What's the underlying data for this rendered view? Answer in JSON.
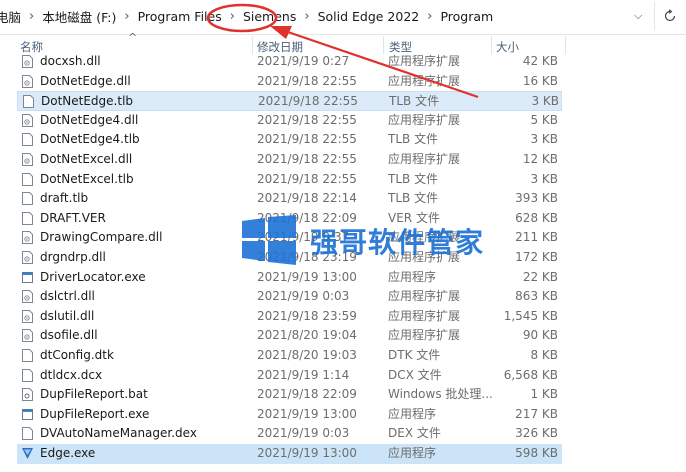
{
  "address": {
    "crumbs": [
      "电脑",
      "本地磁盘 (F:)",
      "Program Files",
      "Siemens",
      "Solid Edge 2022",
      "Program"
    ]
  },
  "columns": {
    "name": "名称",
    "date": "修改日期",
    "type": "类型",
    "size": "大小"
  },
  "files": [
    {
      "name": "docxsh.dll",
      "date": "2021/9/19 0:27",
      "type": "应用程序扩展",
      "size": "42 KB",
      "icon": "dll-file-icon"
    },
    {
      "name": "DotNetEdge.dll",
      "date": "2021/9/18 22:55",
      "type": "应用程序扩展",
      "size": "16 KB",
      "icon": "dll-file-icon"
    },
    {
      "name": "DotNetEdge.tlb",
      "date": "2021/9/18 22:55",
      "type": "TLB 文件",
      "size": "3 KB",
      "icon": "blank-file-icon"
    },
    {
      "name": "DotNetEdge4.dll",
      "date": "2021/9/18 22:55",
      "type": "应用程序扩展",
      "size": "5 KB",
      "icon": "dll-file-icon"
    },
    {
      "name": "DotNetEdge4.tlb",
      "date": "2021/9/18 22:55",
      "type": "TLB 文件",
      "size": "3 KB",
      "icon": "blank-file-icon"
    },
    {
      "name": "DotNetExcel.dll",
      "date": "2021/9/18 22:55",
      "type": "应用程序扩展",
      "size": "12 KB",
      "icon": "dll-file-icon"
    },
    {
      "name": "DotNetExcel.tlb",
      "date": "2021/9/18 22:55",
      "type": "TLB 文件",
      "size": "3 KB",
      "icon": "blank-file-icon"
    },
    {
      "name": "draft.tlb",
      "date": "2021/9/18 22:14",
      "type": "TLB 文件",
      "size": "393 KB",
      "icon": "blank-file-icon"
    },
    {
      "name": "DRAFT.VER",
      "date": "2021/9/18 22:09",
      "type": "VER 文件",
      "size": "628 KB",
      "icon": "blank-file-icon"
    },
    {
      "name": "DrawingCompare.dll",
      "date": "2021/9/19 0:37",
      "type": "应用程序扩展",
      "size": "211 KB",
      "icon": "dll-file-icon"
    },
    {
      "name": "drgndrp.dll",
      "date": "2021/9/18 23:19",
      "type": "应用程序扩展",
      "size": "172 KB",
      "icon": "dll-file-icon"
    },
    {
      "name": "DriverLocator.exe",
      "date": "2021/9/19 13:00",
      "type": "应用程序",
      "size": "22 KB",
      "icon": "exe-file-icon"
    },
    {
      "name": "dslctrl.dll",
      "date": "2021/9/19 0:03",
      "type": "应用程序扩展",
      "size": "863 KB",
      "icon": "dll-file-icon"
    },
    {
      "name": "dslutil.dll",
      "date": "2021/9/18 23:59",
      "type": "应用程序扩展",
      "size": "1,545 KB",
      "icon": "dll-file-icon"
    },
    {
      "name": "dsofile.dll",
      "date": "2021/8/20 19:04",
      "type": "应用程序扩展",
      "size": "90 KB",
      "icon": "dll-file-icon"
    },
    {
      "name": "dtConfig.dtk",
      "date": "2021/8/20 19:03",
      "type": "DTK 文件",
      "size": "8 KB",
      "icon": "blank-file-icon"
    },
    {
      "name": "dtldcx.dcx",
      "date": "2021/9/19 1:14",
      "type": "DCX 文件",
      "size": "6,568 KB",
      "icon": "blank-file-icon"
    },
    {
      "name": "DupFileReport.bat",
      "date": "2021/9/18 22:09",
      "type": "Windows 批处理...",
      "size": "1 KB",
      "icon": "bat-file-icon"
    },
    {
      "name": "DupFileReport.exe",
      "date": "2021/9/19 13:00",
      "type": "应用程序",
      "size": "217 KB",
      "icon": "exe-file-icon"
    },
    {
      "name": "DVAutoNameManager.dex",
      "date": "2021/9/19 0:03",
      "type": "DEX 文件",
      "size": "326 KB",
      "icon": "blank-file-icon"
    },
    {
      "name": "Edge.exe",
      "date": "2021/9/19 13:00",
      "type": "应用程序",
      "size": "598 KB",
      "icon": "solid-edge-app-icon"
    }
  ],
  "watermark": {
    "text": "强哥软件管家",
    "icon": "windows-logo-icon"
  },
  "colors": {
    "accent": "#1e73d6",
    "annotation": "#e0322d",
    "selection": "#dbeaf8"
  }
}
